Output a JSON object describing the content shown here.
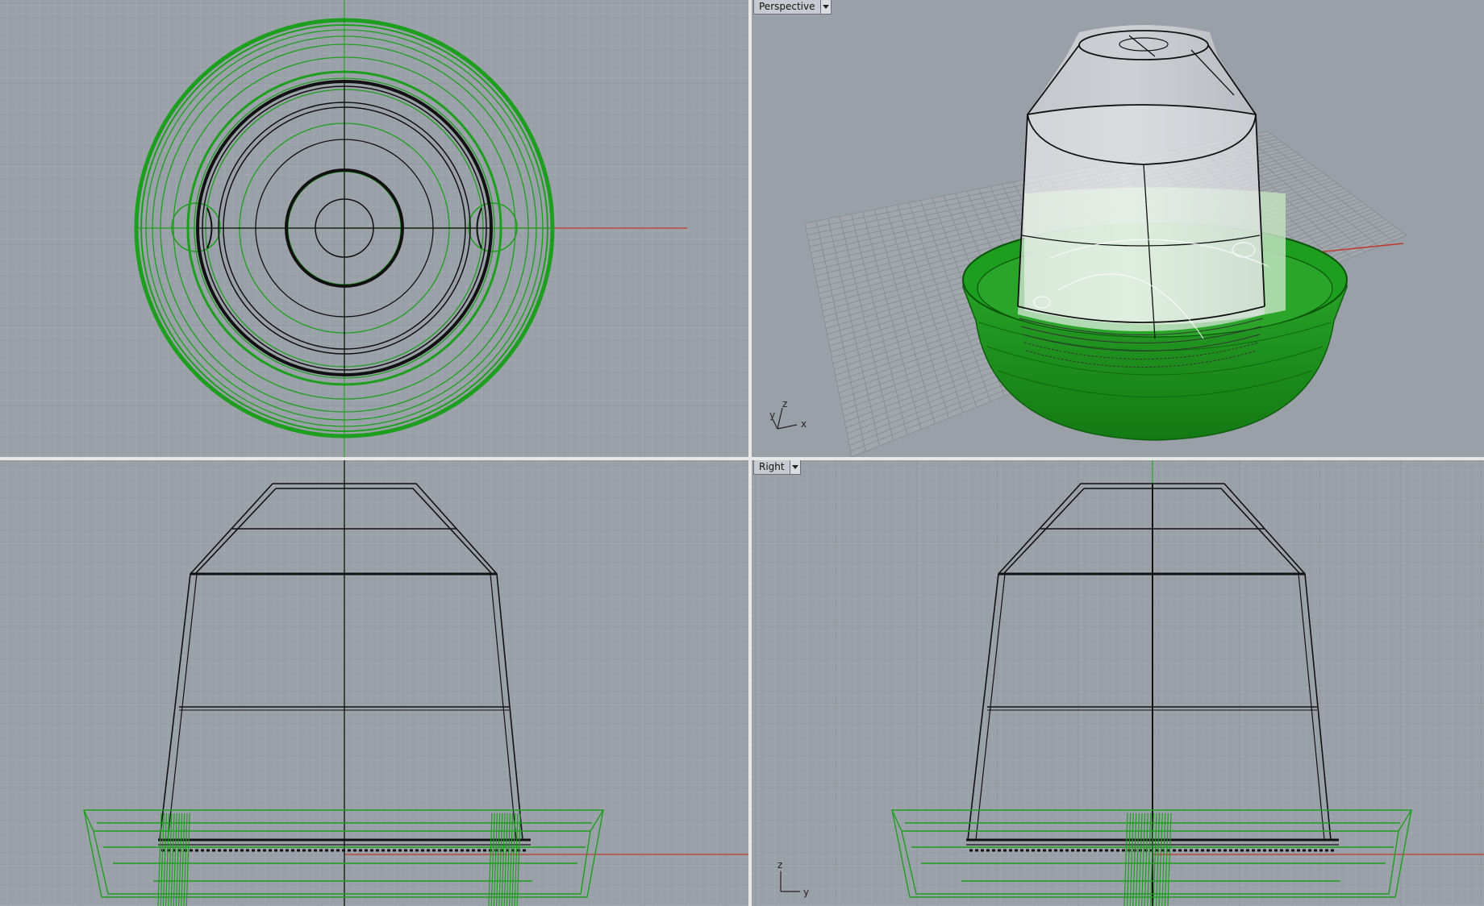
{
  "viewports": {
    "top": {
      "title": ""
    },
    "perspective": {
      "title": "Perspective"
    },
    "front": {
      "title": ""
    },
    "right": {
      "title": "Right"
    }
  },
  "axes": {
    "perspective": {
      "x": "x",
      "y": "y",
      "z": "z"
    },
    "right": {
      "y": "y",
      "z": "z"
    }
  },
  "colors": {
    "viewport_bg": "#9aa0a8",
    "grid_minor": "#a6abb2",
    "grid_major": "#8d9299",
    "model_green": "#1e9e1e",
    "model_wire": "#111111",
    "x_axis": "#c0392b",
    "y_axis": "#27a327"
  },
  "icons": {
    "viewport_menu": "chevron-down-icon",
    "axis_gizmo": "axis-triad-icon"
  }
}
